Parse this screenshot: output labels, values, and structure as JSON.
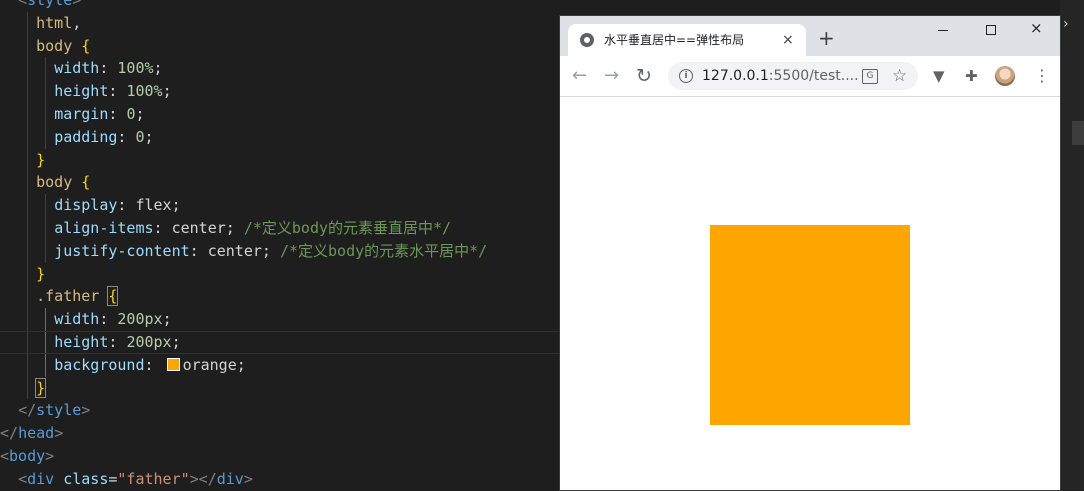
{
  "editor": {
    "code_lines": [
      {
        "indent": "  ",
        "segments": [
          {
            "c": "t-punct",
            "t": "<"
          },
          {
            "c": "t-tag",
            "t": "style"
          },
          {
            "c": "t-punct",
            "t": ">"
          }
        ]
      },
      {
        "indent": "    ",
        "segments": [
          {
            "c": "t-sel",
            "t": "html"
          },
          {
            "c": "t-val",
            "t": ","
          }
        ]
      },
      {
        "indent": "    ",
        "segments": [
          {
            "c": "t-sel",
            "t": "body"
          },
          {
            "c": "t-val",
            "t": " "
          },
          {
            "c": "t-brace",
            "t": "{"
          }
        ]
      },
      {
        "indent": "      ",
        "segments": [
          {
            "c": "t-prop",
            "t": "width"
          },
          {
            "c": "t-val",
            "t": ": "
          },
          {
            "c": "t-num",
            "t": "100%"
          },
          {
            "c": "t-val",
            "t": ";"
          }
        ]
      },
      {
        "indent": "      ",
        "segments": [
          {
            "c": "t-prop",
            "t": "height"
          },
          {
            "c": "t-val",
            "t": ": "
          },
          {
            "c": "t-num",
            "t": "100%"
          },
          {
            "c": "t-val",
            "t": ";"
          }
        ]
      },
      {
        "indent": "      ",
        "segments": [
          {
            "c": "t-prop",
            "t": "margin"
          },
          {
            "c": "t-val",
            "t": ": "
          },
          {
            "c": "t-num",
            "t": "0"
          },
          {
            "c": "t-val",
            "t": ";"
          }
        ]
      },
      {
        "indent": "      ",
        "segments": [
          {
            "c": "t-prop",
            "t": "padding"
          },
          {
            "c": "t-val",
            "t": ": "
          },
          {
            "c": "t-num",
            "t": "0"
          },
          {
            "c": "t-val",
            "t": ";"
          }
        ]
      },
      {
        "indent": "    ",
        "segments": [
          {
            "c": "t-brace",
            "t": "}"
          }
        ]
      },
      {
        "indent": "    ",
        "segments": [
          {
            "c": "t-sel",
            "t": "body"
          },
          {
            "c": "t-val",
            "t": " "
          },
          {
            "c": "t-brace",
            "t": "{"
          }
        ]
      },
      {
        "indent": "      ",
        "segments": [
          {
            "c": "t-prop",
            "t": "display"
          },
          {
            "c": "t-val",
            "t": ": flex;"
          }
        ]
      },
      {
        "indent": "      ",
        "segments": [
          {
            "c": "t-prop",
            "t": "align-items"
          },
          {
            "c": "t-val",
            "t": ": center; "
          },
          {
            "c": "t-comment",
            "t": "/*定义body的元素垂直居中*/"
          }
        ]
      },
      {
        "indent": "      ",
        "segments": [
          {
            "c": "t-prop",
            "t": "justify-content"
          },
          {
            "c": "t-val",
            "t": ": center; "
          },
          {
            "c": "t-comment",
            "t": "/*定义body的元素水平居中*/"
          }
        ]
      },
      {
        "indent": "    ",
        "segments": [
          {
            "c": "t-brace",
            "t": "}"
          }
        ]
      },
      {
        "indent": "    ",
        "segments": [
          {
            "c": "t-sel",
            "t": ".father"
          },
          {
            "c": "t-val",
            "t": " "
          },
          {
            "c": "t-brace box",
            "t": "{"
          }
        ]
      },
      {
        "indent": "      ",
        "segments": [
          {
            "c": "t-prop",
            "t": "width"
          },
          {
            "c": "t-val",
            "t": ": "
          },
          {
            "c": "t-num",
            "t": "200px"
          },
          {
            "c": "t-val",
            "t": ";"
          }
        ]
      },
      {
        "indent": "      ",
        "current": true,
        "segments": [
          {
            "c": "t-prop",
            "t": "height"
          },
          {
            "c": "t-val",
            "t": ": "
          },
          {
            "c": "t-num",
            "t": "200px"
          },
          {
            "c": "t-val",
            "t": ";"
          }
        ]
      },
      {
        "indent": "      ",
        "segments": [
          {
            "c": "t-prop",
            "t": "background"
          },
          {
            "c": "t-val",
            "t": ": "
          },
          {
            "c": "swatch",
            "t": ""
          },
          {
            "c": "t-val",
            "t": "orange;"
          }
        ]
      },
      {
        "indent": "    ",
        "segments": [
          {
            "c": "t-brace box",
            "t": "}"
          }
        ]
      },
      {
        "indent": "  ",
        "segments": [
          {
            "c": "t-punct",
            "t": "</"
          },
          {
            "c": "t-tag",
            "t": "style"
          },
          {
            "c": "t-punct",
            "t": ">"
          }
        ]
      },
      {
        "indent": "",
        "segments": [
          {
            "c": "t-punct",
            "t": "</"
          },
          {
            "c": "t-tag",
            "t": "head"
          },
          {
            "c": "t-punct",
            "t": ">"
          }
        ]
      },
      {
        "indent": "",
        "segments": [
          {
            "c": "t-punct",
            "t": "<"
          },
          {
            "c": "t-tag",
            "t": "body"
          },
          {
            "c": "t-punct",
            "t": ">"
          }
        ]
      },
      {
        "indent": "  ",
        "segments": [
          {
            "c": "t-punct",
            "t": "<"
          },
          {
            "c": "t-tag",
            "t": "div"
          },
          {
            "c": "t-val",
            "t": " "
          },
          {
            "c": "t-attr",
            "t": "class"
          },
          {
            "c": "t-val",
            "t": "="
          },
          {
            "c": "t-str",
            "t": "\"father\""
          },
          {
            "c": "t-punct",
            "t": "></"
          },
          {
            "c": "t-tag",
            "t": "div"
          },
          {
            "c": "t-punct",
            "t": ">"
          }
        ]
      }
    ],
    "side_chevron": "›",
    "swatch_color": "#ffa500"
  },
  "browser": {
    "tab_title": "水平垂直居中==弹性布局",
    "tab_close": "×",
    "new_tab": "+",
    "window_close": "×",
    "nav_back": "←",
    "nav_forward": "→",
    "nav_reload": "↻",
    "info_icon": "i",
    "url_host": "127.0.0.1",
    "url_rest": ":5500/test....",
    "translate_icon": "G",
    "star_icon": "☆",
    "ext_icon": "▼",
    "puzzle_icon": "✚",
    "menu_icon": "⋮",
    "father_color": "#ffa500"
  }
}
